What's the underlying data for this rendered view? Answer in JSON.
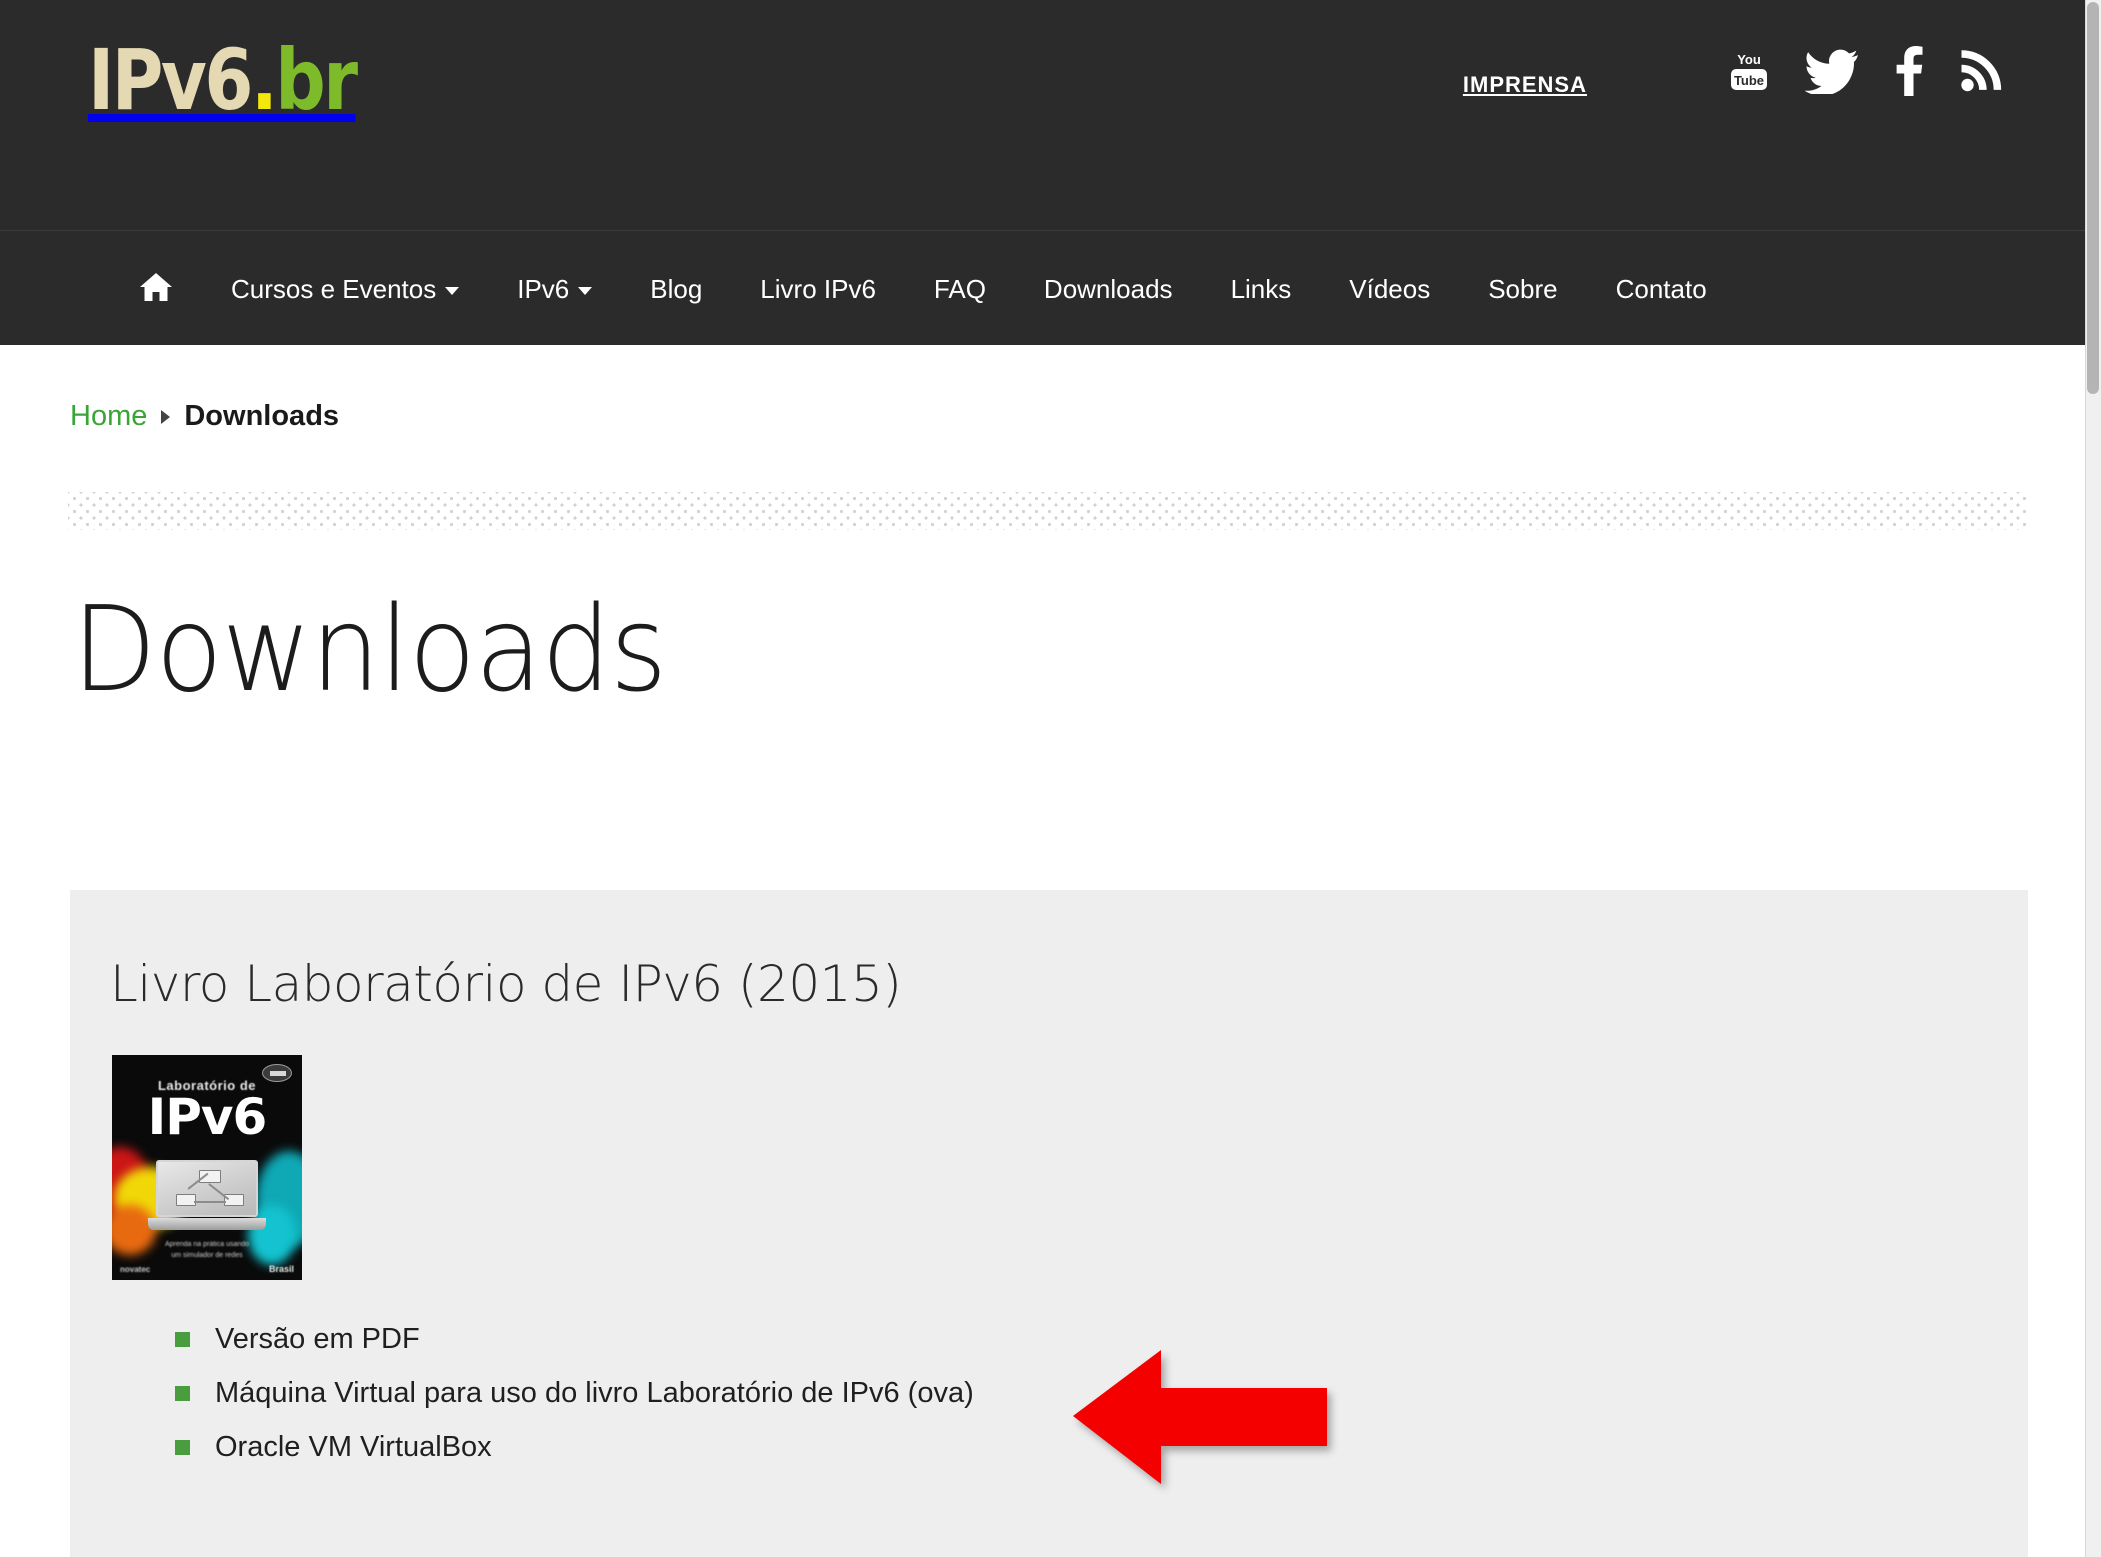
{
  "brand": {
    "logo_prefix": "IPv6",
    "logo_dot": ".",
    "logo_suffix": "br",
    "colors": {
      "header_bg": "#2b2b2b",
      "logo_tan": "#e4d9b2",
      "logo_green": "#7dbb2a",
      "logo_yellow": "#f2e80d",
      "link_green": "#3aa537",
      "bullet_green": "#4a9d3e",
      "panel_bg": "#eeeeee",
      "arrow_red": "#f50000"
    }
  },
  "header": {
    "press_label": "IMPRENSA",
    "social": [
      {
        "name": "youtube-icon",
        "label": "YouTube"
      },
      {
        "name": "twitter-icon",
        "label": "Twitter"
      },
      {
        "name": "facebook-icon",
        "label": "Facebook"
      },
      {
        "name": "rss-icon",
        "label": "RSS"
      }
    ]
  },
  "nav": {
    "home_icon": "home-icon",
    "items": [
      {
        "label": "Cursos e Eventos",
        "has_caret": true
      },
      {
        "label": "IPv6",
        "has_caret": true
      },
      {
        "label": "Blog",
        "has_caret": false
      },
      {
        "label": "Livro IPv6",
        "has_caret": false
      },
      {
        "label": "FAQ",
        "has_caret": false
      },
      {
        "label": "Downloads",
        "has_caret": false
      },
      {
        "label": "Links",
        "has_caret": false
      },
      {
        "label": "Vídeos",
        "has_caret": false
      },
      {
        "label": "Sobre",
        "has_caret": false
      },
      {
        "label": "Contato",
        "has_caret": false
      }
    ]
  },
  "breadcrumb": {
    "home": "Home",
    "current": "Downloads"
  },
  "page": {
    "title": "Downloads"
  },
  "section": {
    "title": "Livro Laboratório de IPv6 (2015)",
    "book_cover": {
      "alt": "Livro Laboratório de IPv6",
      "subtitle": "Laboratório de",
      "title": "IPv6",
      "footer_line1": "Aprenda na prática usando",
      "footer_line2": "um simulador de redes",
      "publisher_left": "novatec",
      "publisher_right": "Brasil"
    },
    "downloads": [
      {
        "label": "Versão em PDF"
      },
      {
        "label": "Máquina Virtual para uso do livro Laboratório de IPv6 (ova)"
      },
      {
        "label": "Oracle VM VirtualBox"
      }
    ]
  },
  "annotation": {
    "arrow": {
      "name": "red-arrow-annotation",
      "direction": "left",
      "points_to": "Máquina Virtual para uso do livro Laboratório de IPv6 (ova)"
    }
  }
}
